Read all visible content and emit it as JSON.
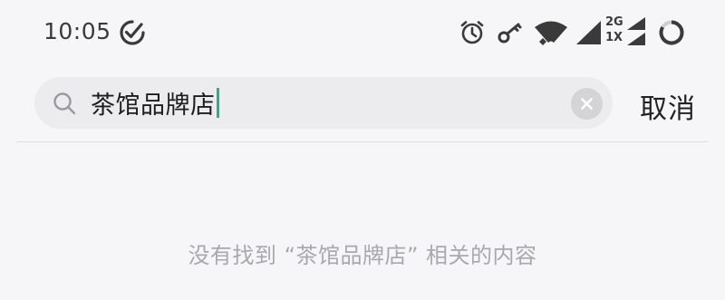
{
  "status_bar": {
    "time": "10:05",
    "icons": [
      "check-circle-icon",
      "alarm-icon",
      "key-icon",
      "wifi-icon",
      "cell-signal-icon",
      "2g-1x-signal-icon",
      "battery-ring-icon"
    ],
    "network_top": "2G",
    "network_bottom": "1X"
  },
  "search": {
    "query": "茶馆品牌店",
    "clear_icon": "close-icon",
    "search_icon": "search-icon"
  },
  "header": {
    "cancel_label": "取消"
  },
  "results": {
    "empty_message": "没有找到 “茶馆品牌店” 相关的内容"
  },
  "colors": {
    "background": "#f6f6f8",
    "search_box": "#ececef",
    "caret": "#21b38c",
    "muted_text": "#a9a9ad"
  }
}
